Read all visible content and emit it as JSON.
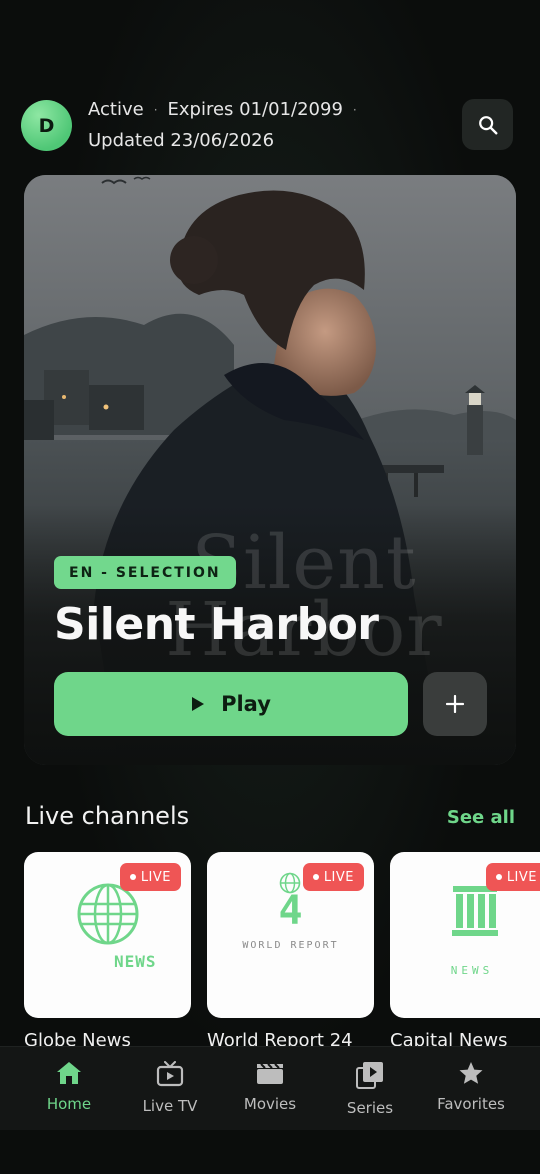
{
  "header": {
    "avatar_letter": "D",
    "status": "Active",
    "expires": "Expires 01/01/2099",
    "separator": "·",
    "updated": "Updated 23/06/2026",
    "search_icon": "search-icon"
  },
  "hero": {
    "ghost_title": "Silent Harbor",
    "badge": "EN - SELECTION",
    "title": "Silent Harbor",
    "play_label": "Play",
    "play_icon": "play-icon",
    "add_icon": "plus-icon"
  },
  "live_channels": {
    "title": "Live channels",
    "see_all": "See all",
    "items": [
      {
        "name": "Globe News",
        "badge": "LIVE",
        "logo_text": "NEWS",
        "icon": "globe-icon"
      },
      {
        "name": "World Report 24",
        "badge": "LIVE",
        "logo_number": "4",
        "logo_text": "WORLD REPORT",
        "icon": "globe-icon"
      },
      {
        "name": "Capital News",
        "badge": "LIVE",
        "logo_text": "NEWS",
        "icon": "capitol-building-icon"
      }
    ]
  },
  "nav": {
    "items": [
      {
        "label": "Home",
        "icon": "home-icon",
        "active": true
      },
      {
        "label": "Live TV",
        "icon": "tv-icon",
        "active": false
      },
      {
        "label": "Movies",
        "icon": "clapperboard-icon",
        "active": false
      },
      {
        "label": "Series",
        "icon": "series-icon",
        "active": false
      },
      {
        "label": "Favorites",
        "icon": "star-icon",
        "active": false
      }
    ]
  },
  "colors": {
    "accent": "#6fd68a",
    "live": "#ef5555",
    "background": "#0b0d0c"
  }
}
